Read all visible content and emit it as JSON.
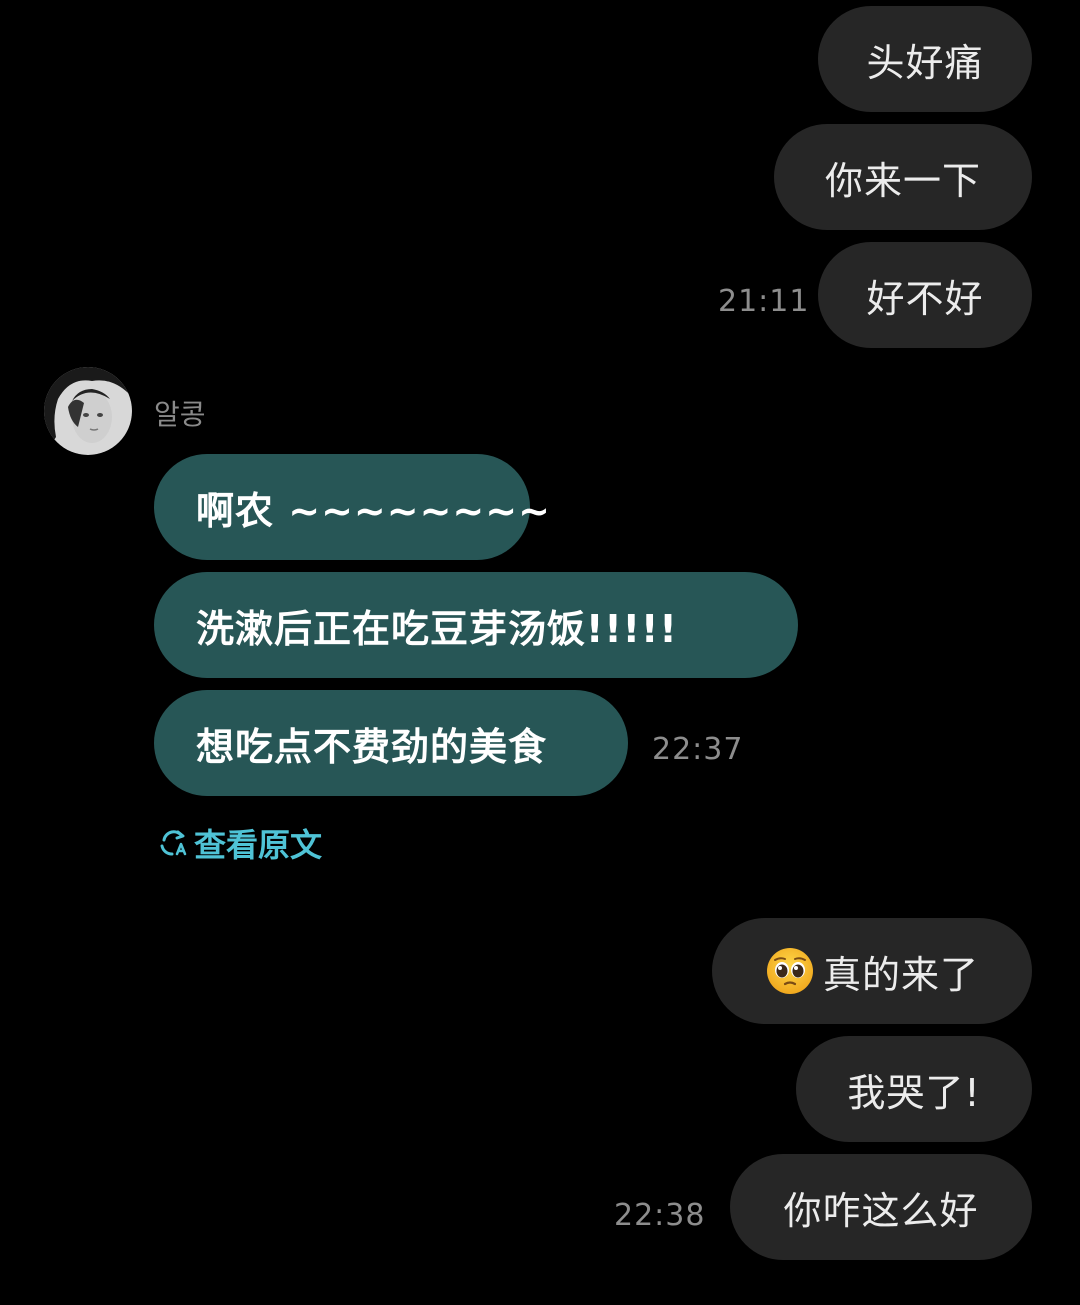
{
  "outgoing_top": [
    {
      "text": "头好痛"
    },
    {
      "text": "你来一下"
    },
    {
      "text": "好不好"
    }
  ],
  "time_1": "21:11",
  "sender": {
    "name": "알콩"
  },
  "incoming": [
    {
      "text": "啊农 ~~~~~~~~"
    },
    {
      "text": "洗漱后正在吃豆芽汤饭!!!!!"
    },
    {
      "text": "想吃点不费劲的美食"
    }
  ],
  "time_2": "22:37",
  "translate": {
    "label": "查看原文",
    "icon": "translate-icon"
  },
  "outgoing_bottom": [
    {
      "text": "真的来了",
      "emoji": "pleading-face-emoji"
    },
    {
      "text": "我哭了!"
    },
    {
      "text": "你咋这么好"
    }
  ],
  "time_3": "22:38",
  "colors": {
    "background": "#000000",
    "outgoing_bubble": "#262626",
    "incoming_bubble": "#275656",
    "link": "#4fc3d6",
    "timestamp": "#8d8d8d"
  }
}
